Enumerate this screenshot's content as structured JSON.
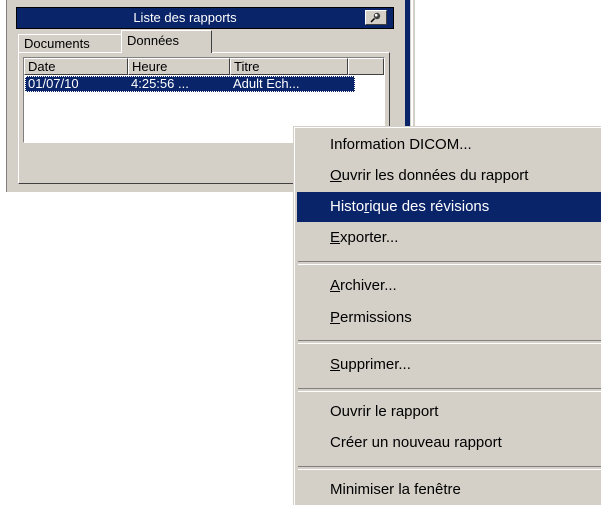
{
  "window": {
    "title": "Liste des rapports"
  },
  "tabs": [
    {
      "label": "Documents",
      "active": false
    },
    {
      "label": "Données",
      "active": true
    }
  ],
  "table": {
    "columns": [
      "Date",
      "Heure",
      "Titre"
    ],
    "rows": [
      {
        "date": "01/07/10",
        "time": "4:25:56 ...",
        "title": "Adult Ech..."
      }
    ]
  },
  "context_menu": {
    "items": [
      {
        "label": "Information DICOM...",
        "underline": null
      },
      {
        "label": "Ouvrir les données du rapport",
        "underline": "O"
      },
      {
        "label": "Historique des révisions",
        "underline": "r",
        "highlighted": true
      },
      {
        "label": "Exporter...",
        "underline": "E"
      },
      {
        "label": "Archiver...",
        "underline": "A"
      },
      {
        "label": "Permissions",
        "underline": "P"
      },
      {
        "label": "Supprimer...",
        "underline": "S"
      },
      {
        "label": "Ouvrir le rapport",
        "underline": null
      },
      {
        "label": "Créer un nouveau rapport",
        "underline": null
      },
      {
        "label": "Minimiser la fenêtre",
        "underline": null
      }
    ]
  },
  "colors": {
    "titlebar": "#0a246a",
    "highlight": "#0a246a",
    "face": "#d4d0c8"
  },
  "icons": {
    "pin": "pin-icon"
  }
}
